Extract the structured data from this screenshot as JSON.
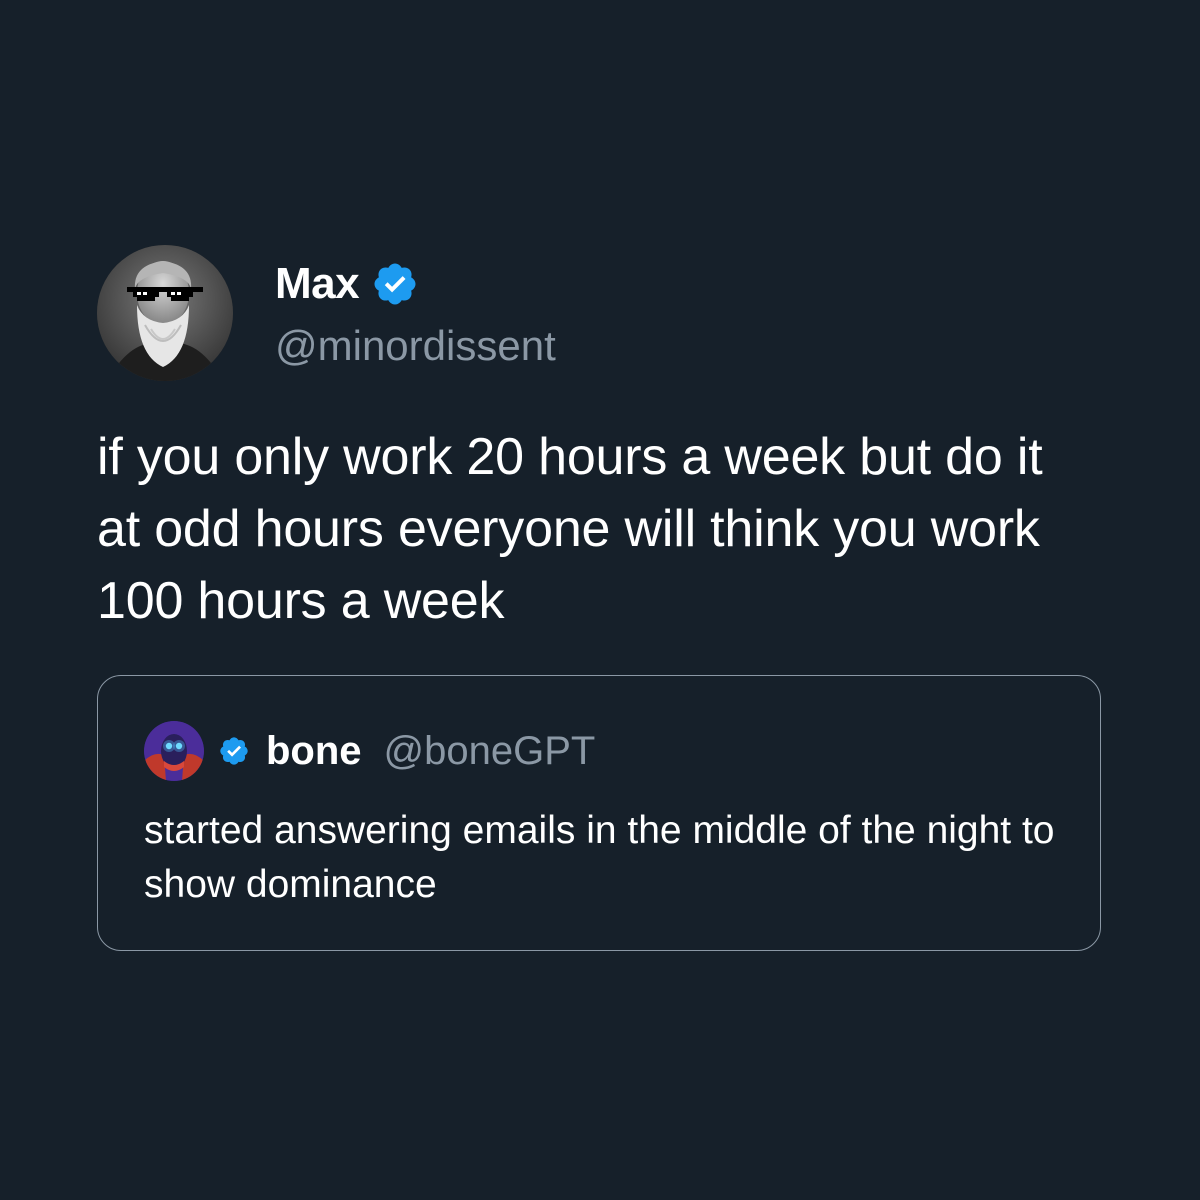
{
  "tweet": {
    "author": {
      "name": "Max",
      "handle": "@minordissent",
      "verified": true,
      "avatar_icon": "bearded-man-with-pixel-sunglasses-avatar"
    },
    "text": "if you only work 20 hours a week but do it at odd hours everyone will think you work 100 hours a week"
  },
  "quote": {
    "author": {
      "name": "bone",
      "handle": "@boneGPT",
      "verified": true,
      "avatar_icon": "red-glowing-eyes-avatar"
    },
    "text": "started answering emails in the middle of the night to show dominance"
  },
  "colors": {
    "background": "#16202a",
    "text": "#ffffff",
    "secondary_text": "#8b98a5",
    "verified_badge": "#1d9bf0",
    "card_border": "#8b98a5"
  }
}
